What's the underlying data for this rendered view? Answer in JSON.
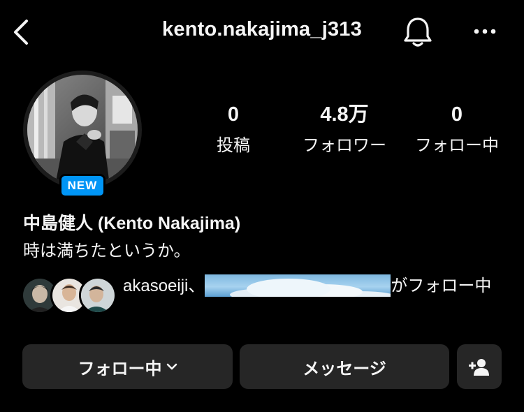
{
  "header": {
    "username": "kento.nakajima_j313"
  },
  "profile": {
    "badge": "NEW",
    "stats": [
      {
        "value": "0",
        "label": "投稿"
      },
      {
        "value": "4.8万",
        "label": "フォロワー"
      },
      {
        "value": "0",
        "label": "フォロー中"
      }
    ],
    "display_name": "中島健人 (Kento Nakajima)",
    "bio": "時は満ちたというか。"
  },
  "followed_by": {
    "name": "akasoeiji、",
    "suffix": "がフォロー中"
  },
  "actions": {
    "following_label": "フォロー中",
    "message_label": "メッセージ"
  },
  "icons": {
    "back": "back-chevron-icon",
    "bell": "bell-icon",
    "more": "more-icon",
    "add_user": "add-user-icon",
    "dropdown": "chevron-down-icon"
  },
  "colors": {
    "background": "#000000",
    "button": "#262626",
    "badge": "#0095f6",
    "text": "#f5f5f5"
  }
}
